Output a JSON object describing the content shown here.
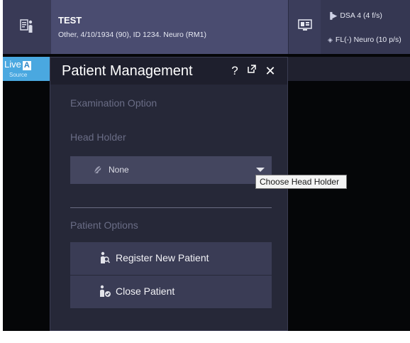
{
  "header": {
    "patient_icon": "patient-card-icon",
    "patient_name": "TEST",
    "patient_details": "Other, 4/10/1934 (90), ID 1234. Neuro (RM1)",
    "monitor_icon": "monitor-icon",
    "protocols": [
      {
        "icon": "play-icon",
        "label": "DSA 4 (4 f/s)"
      },
      {
        "icon": "eye-icon",
        "label": "FL(-) Neuro (10 p/s)"
      }
    ]
  },
  "live_tab": {
    "label": "Live",
    "badge": "A",
    "sub": "Source"
  },
  "panel": {
    "title": "Patient Management",
    "help_label": "?",
    "popout_icon": "popout-icon",
    "close_label": "✕",
    "exam_section": "Examination Option",
    "head_holder_section": "Head Holder",
    "head_holder": {
      "icon": "head-holder-icon",
      "value": "None"
    },
    "patient_section": "Patient Options",
    "register_button": {
      "icon": "register-patient-icon",
      "label": "Register New Patient"
    },
    "close_patient_button": {
      "icon": "close-patient-icon",
      "label": "Close Patient"
    }
  },
  "tooltip": "Choose Head Holder",
  "colors": {
    "header_bg": "#4a4c70",
    "panel_bg": "#262838",
    "live_tab": "#4aa8e0",
    "button_bg": "#3a3c55"
  }
}
